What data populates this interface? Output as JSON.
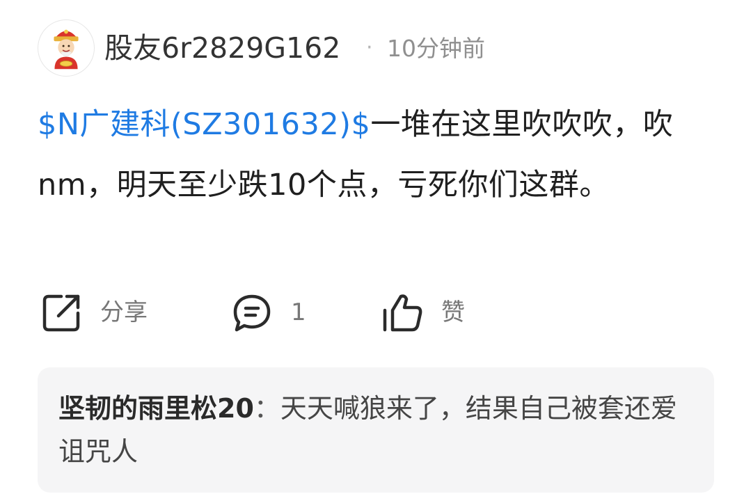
{
  "post": {
    "username": "股友6r2829G162",
    "separator": "·",
    "time": "10分钟前",
    "stock_tag": "$N广建科(SZ301632)$",
    "text": "一堆在这里吹吹吹，吹nm，明天至少跌10个点，亏死你们这群。",
    "actions": {
      "share_label": "分享",
      "comment_count": "1",
      "like_label": "赞"
    }
  },
  "reply": {
    "author": "坚韧的雨里松20",
    "separator": "：",
    "text": "天天喊狼来了，结果自己被套还爱诅咒人"
  },
  "colors": {
    "link": "#1f7be3",
    "reply_background": "#f5f5f6",
    "muted_text": "#8f8f8f"
  },
  "icons": {
    "avatar": "cartoon-fortune-god-avatar",
    "share": "share-icon",
    "comment": "comment-icon",
    "like": "thumbs-up-icon"
  }
}
